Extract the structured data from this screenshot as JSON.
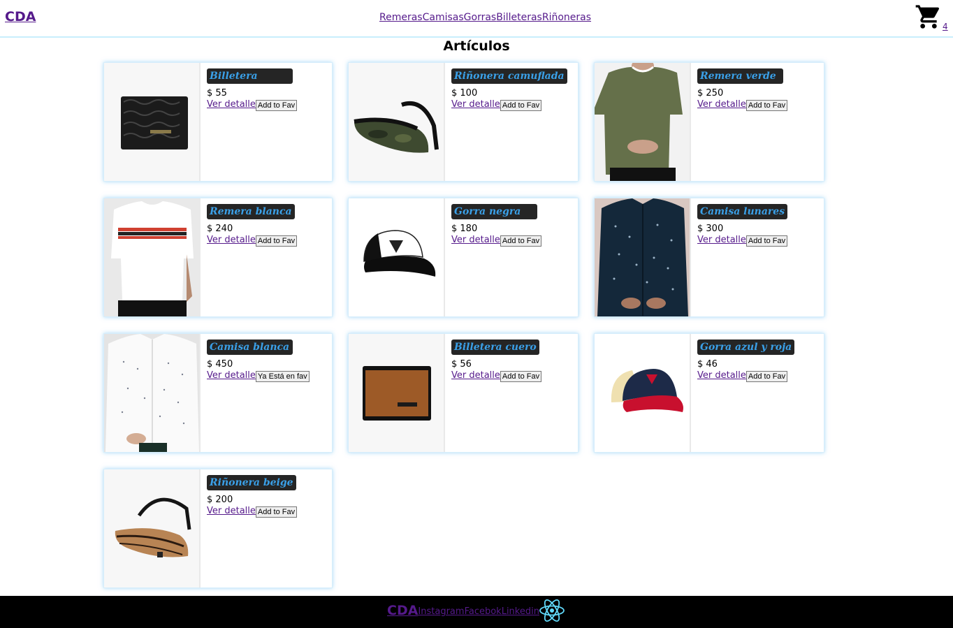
{
  "header": {
    "brand": "CDA",
    "nav": [
      "Remeras",
      "Camisas",
      "Gorras",
      "Billeteras",
      "Riñoneras"
    ],
    "cart_icon": "shopping-cart-icon",
    "cart_count": "4"
  },
  "main": {
    "title": "Artículos",
    "products": [
      {
        "name": "Billetera",
        "price": "$ 55",
        "detail": "Ver detalle",
        "fav": "Add to Fav",
        "image": "black-wallet"
      },
      {
        "name": "Riñonera camuflada",
        "price": "$ 100",
        "detail": "Ver detalle",
        "fav": "Add to Fav",
        "image": "camo-fanny-pack"
      },
      {
        "name": "Remera verde",
        "price": "$ 250",
        "detail": "Ver detalle",
        "fav": "Add to Fav",
        "image": "green-tshirt"
      },
      {
        "name": "Remera blanca",
        "price": "$ 240",
        "detail": "Ver detalle",
        "fav": "Add to Fav",
        "image": "white-striped-tshirt"
      },
      {
        "name": "Gorra negra",
        "price": "$ 180",
        "detail": "Ver detalle",
        "fav": "Add to Fav",
        "image": "black-white-cap"
      },
      {
        "name": "Camisa lunares",
        "price": "$ 300",
        "detail": "Ver detalle",
        "fav": "Add to Fav",
        "image": "navy-dotted-shirt"
      },
      {
        "name": "Camisa blanca",
        "price": "$ 450",
        "detail": "Ver detalle",
        "fav": "Ya Está en fav",
        "image": "white-dotted-shirt"
      },
      {
        "name": "Billetera cuero",
        "price": "$ 56",
        "detail": "Ver detalle",
        "fav": "Add to Fav",
        "image": "brown-wallet"
      },
      {
        "name": "Gorra azul y roja",
        "price": "$ 46",
        "detail": "Ver detalle",
        "fav": "Add to Fav",
        "image": "blue-red-cap"
      },
      {
        "name": "Riñonera beige",
        "price": "$ 200",
        "detail": "Ver detalle",
        "fav": "Add to Fav",
        "image": "beige-fanny-pack"
      }
    ]
  },
  "footer": {
    "brand": "CDA",
    "links": [
      "Instagram",
      "Facebok",
      "Linkedin"
    ],
    "logo_icon": "react-logo-icon"
  },
  "colors": {
    "link": "#551a8b",
    "product_name_text": "#3aa0e8",
    "product_name_bg": "#252525",
    "footer_bg": "#000000",
    "card_glow": "#78c3f5"
  }
}
